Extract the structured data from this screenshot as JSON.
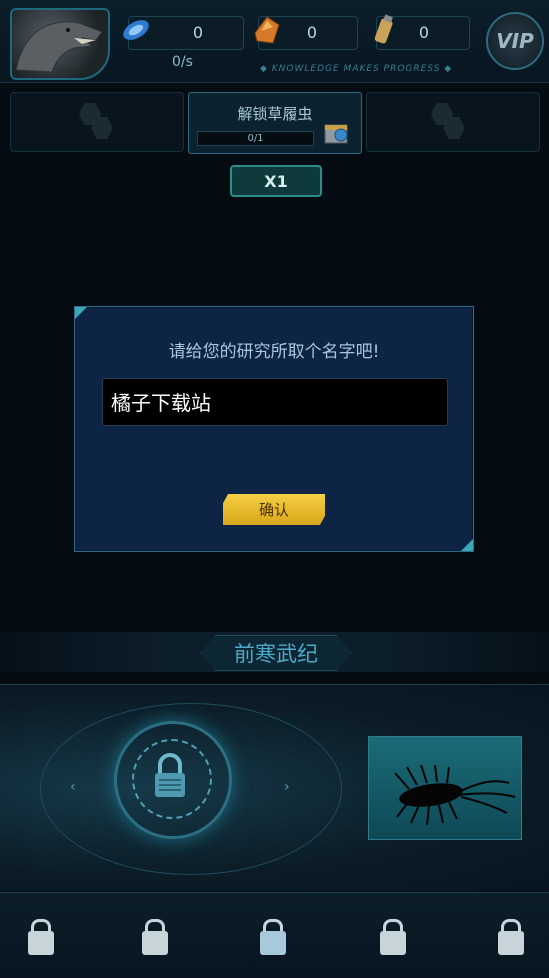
{
  "resources": [
    {
      "icon": "blue-crystal-icon",
      "value": "0"
    },
    {
      "icon": "amber-gem-icon",
      "value": "0"
    },
    {
      "icon": "canister-icon",
      "value": "0"
    }
  ],
  "rate": "0/s",
  "motto": "◆ KNOWLEDGE MAKES PROGRESS ◆",
  "vip_label": "VIP",
  "unlock": {
    "title": "解锁草履虫",
    "progress": "0/1",
    "progress_fraction": 0.0
  },
  "multiplier": "X1",
  "dialog": {
    "title": "请给您的研究所取个名字吧!",
    "input_value": "橘子下载站",
    "confirm_label": "确认"
  },
  "era": {
    "label": "前寒武纪"
  },
  "colors": {
    "accent": "#2a8d87",
    "confirm": "#f4cf45",
    "dialog_bg": "#0d2445"
  },
  "nav": [
    {
      "icon": "lock-icon"
    },
    {
      "icon": "lock-icon"
    },
    {
      "icon": "lock-upgrade-icon"
    },
    {
      "icon": "lock-icon"
    },
    {
      "icon": "lock-icon"
    }
  ]
}
